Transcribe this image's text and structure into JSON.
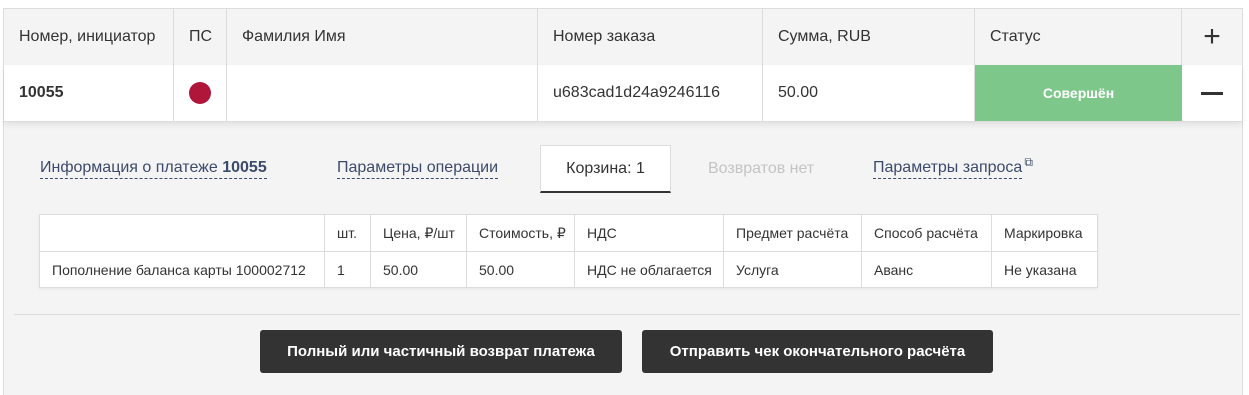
{
  "table": {
    "headers": {
      "initiator": "Номер, инициатор",
      "ps": "ПС",
      "name": "Фамилия Имя",
      "order": "Номер заказа",
      "amount": "Сумма, RUB",
      "status": "Статус"
    },
    "row": {
      "initiator": "10055",
      "ps_color": "#b0163a",
      "name": "",
      "order": "u683cad1d24a9246116",
      "amount": "50.00",
      "status": "Совершён",
      "status_color": "#7dc78a"
    }
  },
  "tabs": {
    "payment_info_prefix": "Информация о платеже ",
    "payment_info_number": "10055",
    "operation_params": "Параметры операции",
    "cart": "Корзина: 1",
    "returns": "Возвратов нет",
    "request_params": "Параметры запроса",
    "request_params_icon": "external-window-icon"
  },
  "cart_table": {
    "headers": [
      "",
      "шт.",
      "Цена, ₽/шт",
      "Стоимость, ₽",
      "НДС",
      "Предмет расчёта",
      "Способ расчёта",
      "Маркировка"
    ],
    "rows": [
      [
        "Пополнение баланса карты 100002712",
        "1",
        "50.00",
        "50.00",
        "НДС не облагается",
        "Услуга",
        "Аванс",
        "Не указана"
      ]
    ]
  },
  "buttons": {
    "refund": "Полный или частичный возврат платежа",
    "send_receipt": "Отправить чек окончательного расчёта"
  }
}
